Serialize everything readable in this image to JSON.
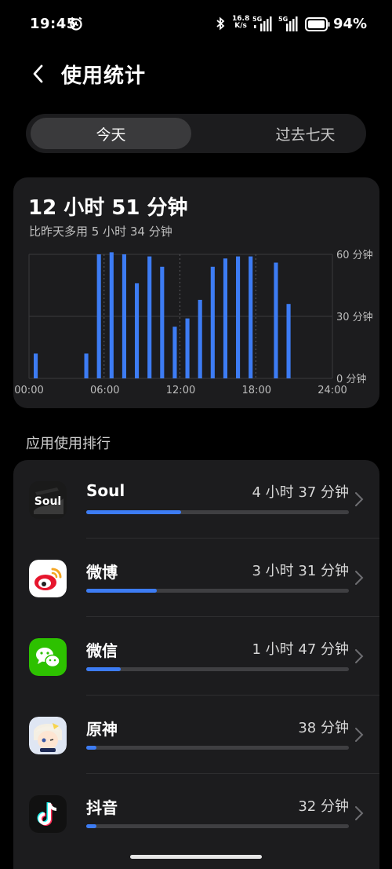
{
  "status_bar": {
    "time": "19:45",
    "net_speed_value": "16.8",
    "net_speed_unit": "K/s",
    "sim1_label": "5G",
    "sim2_label": "5G",
    "battery": "94%",
    "icons": [
      "alarm-icon",
      "bluetooth-icon",
      "signal-icon",
      "battery-icon"
    ]
  },
  "header": {
    "back_icon": "chevron-left-icon",
    "title": "使用统计"
  },
  "tabs": [
    {
      "label": "今天",
      "selected": true
    },
    {
      "label": "过去七天",
      "selected": false
    }
  ],
  "summary": {
    "total": "12 小时 51 分钟",
    "compare": "比昨天多用 5 小时 34 分钟"
  },
  "chart_data": {
    "type": "bar",
    "unit": "分钟",
    "ylim": [
      0,
      60
    ],
    "yticks": [
      "60 分钟",
      "30 分钟",
      "0 分钟"
    ],
    "xticks": [
      "00:00",
      "06:00",
      "12:00",
      "18:00",
      "24:00"
    ],
    "bar_color": "#3d7cf4",
    "values": [
      12,
      0,
      0,
      0,
      12,
      60,
      61,
      60,
      46,
      59,
      54,
      25,
      29,
      38,
      54,
      58,
      59,
      59,
      0,
      56,
      36,
      0,
      0,
      0
    ]
  },
  "ranking": {
    "title": "应用使用排行",
    "apps": [
      {
        "name": "Soul",
        "time": "4 小时 37 分钟",
        "fraction": 0.36,
        "icon": "soul-app-icon"
      },
      {
        "name": "微博",
        "time": "3 小时 31 分钟",
        "fraction": 0.27,
        "icon": "weibo-app-icon"
      },
      {
        "name": "微信",
        "time": "1 小时 47 分钟",
        "fraction": 0.13,
        "icon": "wechat-app-icon"
      },
      {
        "name": "原神",
        "time": "38 分钟",
        "fraction": 0.04,
        "icon": "genshin-app-icon"
      },
      {
        "name": "抖音",
        "time": "32 分钟",
        "fraction": 0.04,
        "icon": "douyin-app-icon"
      }
    ]
  },
  "colors": {
    "accent": "#3d7cf4",
    "card": "#1c1c1e",
    "background": "#000000"
  }
}
